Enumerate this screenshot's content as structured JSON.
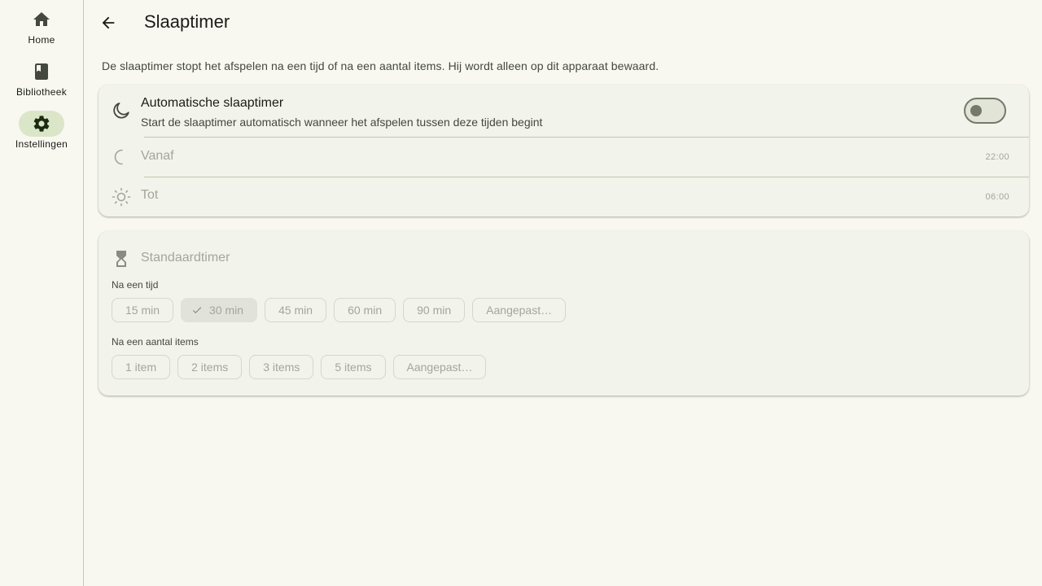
{
  "rail": {
    "items": [
      {
        "label": "Home",
        "icon": "home-icon"
      },
      {
        "label": "Bibliotheek",
        "icon": "book-icon"
      },
      {
        "label": "Instellingen",
        "icon": "gear-icon",
        "active": true
      }
    ]
  },
  "header": {
    "title": "Slaaptimer"
  },
  "intro": "De slaaptimer stopt het afspelen na een tijd of na een aantal items. Hij wordt alleen op dit apparaat bewaard.",
  "auto": {
    "title": "Automatische slaaptimer",
    "subtitle": "Start de slaaptimer automatisch wanneer het afspelen tussen deze tijden begint",
    "enabled": false,
    "from_label": "Vanaf",
    "from_value": "22:00",
    "to_label": "Tot",
    "to_value": "06:00"
  },
  "default_timer": {
    "title": "Standaardtimer",
    "time_label": "Na een tijd",
    "time_options": [
      "15 min",
      "30 min",
      "45 min",
      "60 min",
      "90 min",
      "Aangepast…"
    ],
    "time_selected": "30 min",
    "items_label": "Na een aantal items",
    "items_options": [
      "1 item",
      "2 items",
      "3 items",
      "5 items",
      "Aangepast…"
    ]
  },
  "colors": {
    "background": "#f8f8f1",
    "card": "#f2f3ea",
    "active_pill": "#dbe6c8",
    "muted_text": "#a4a69c"
  }
}
